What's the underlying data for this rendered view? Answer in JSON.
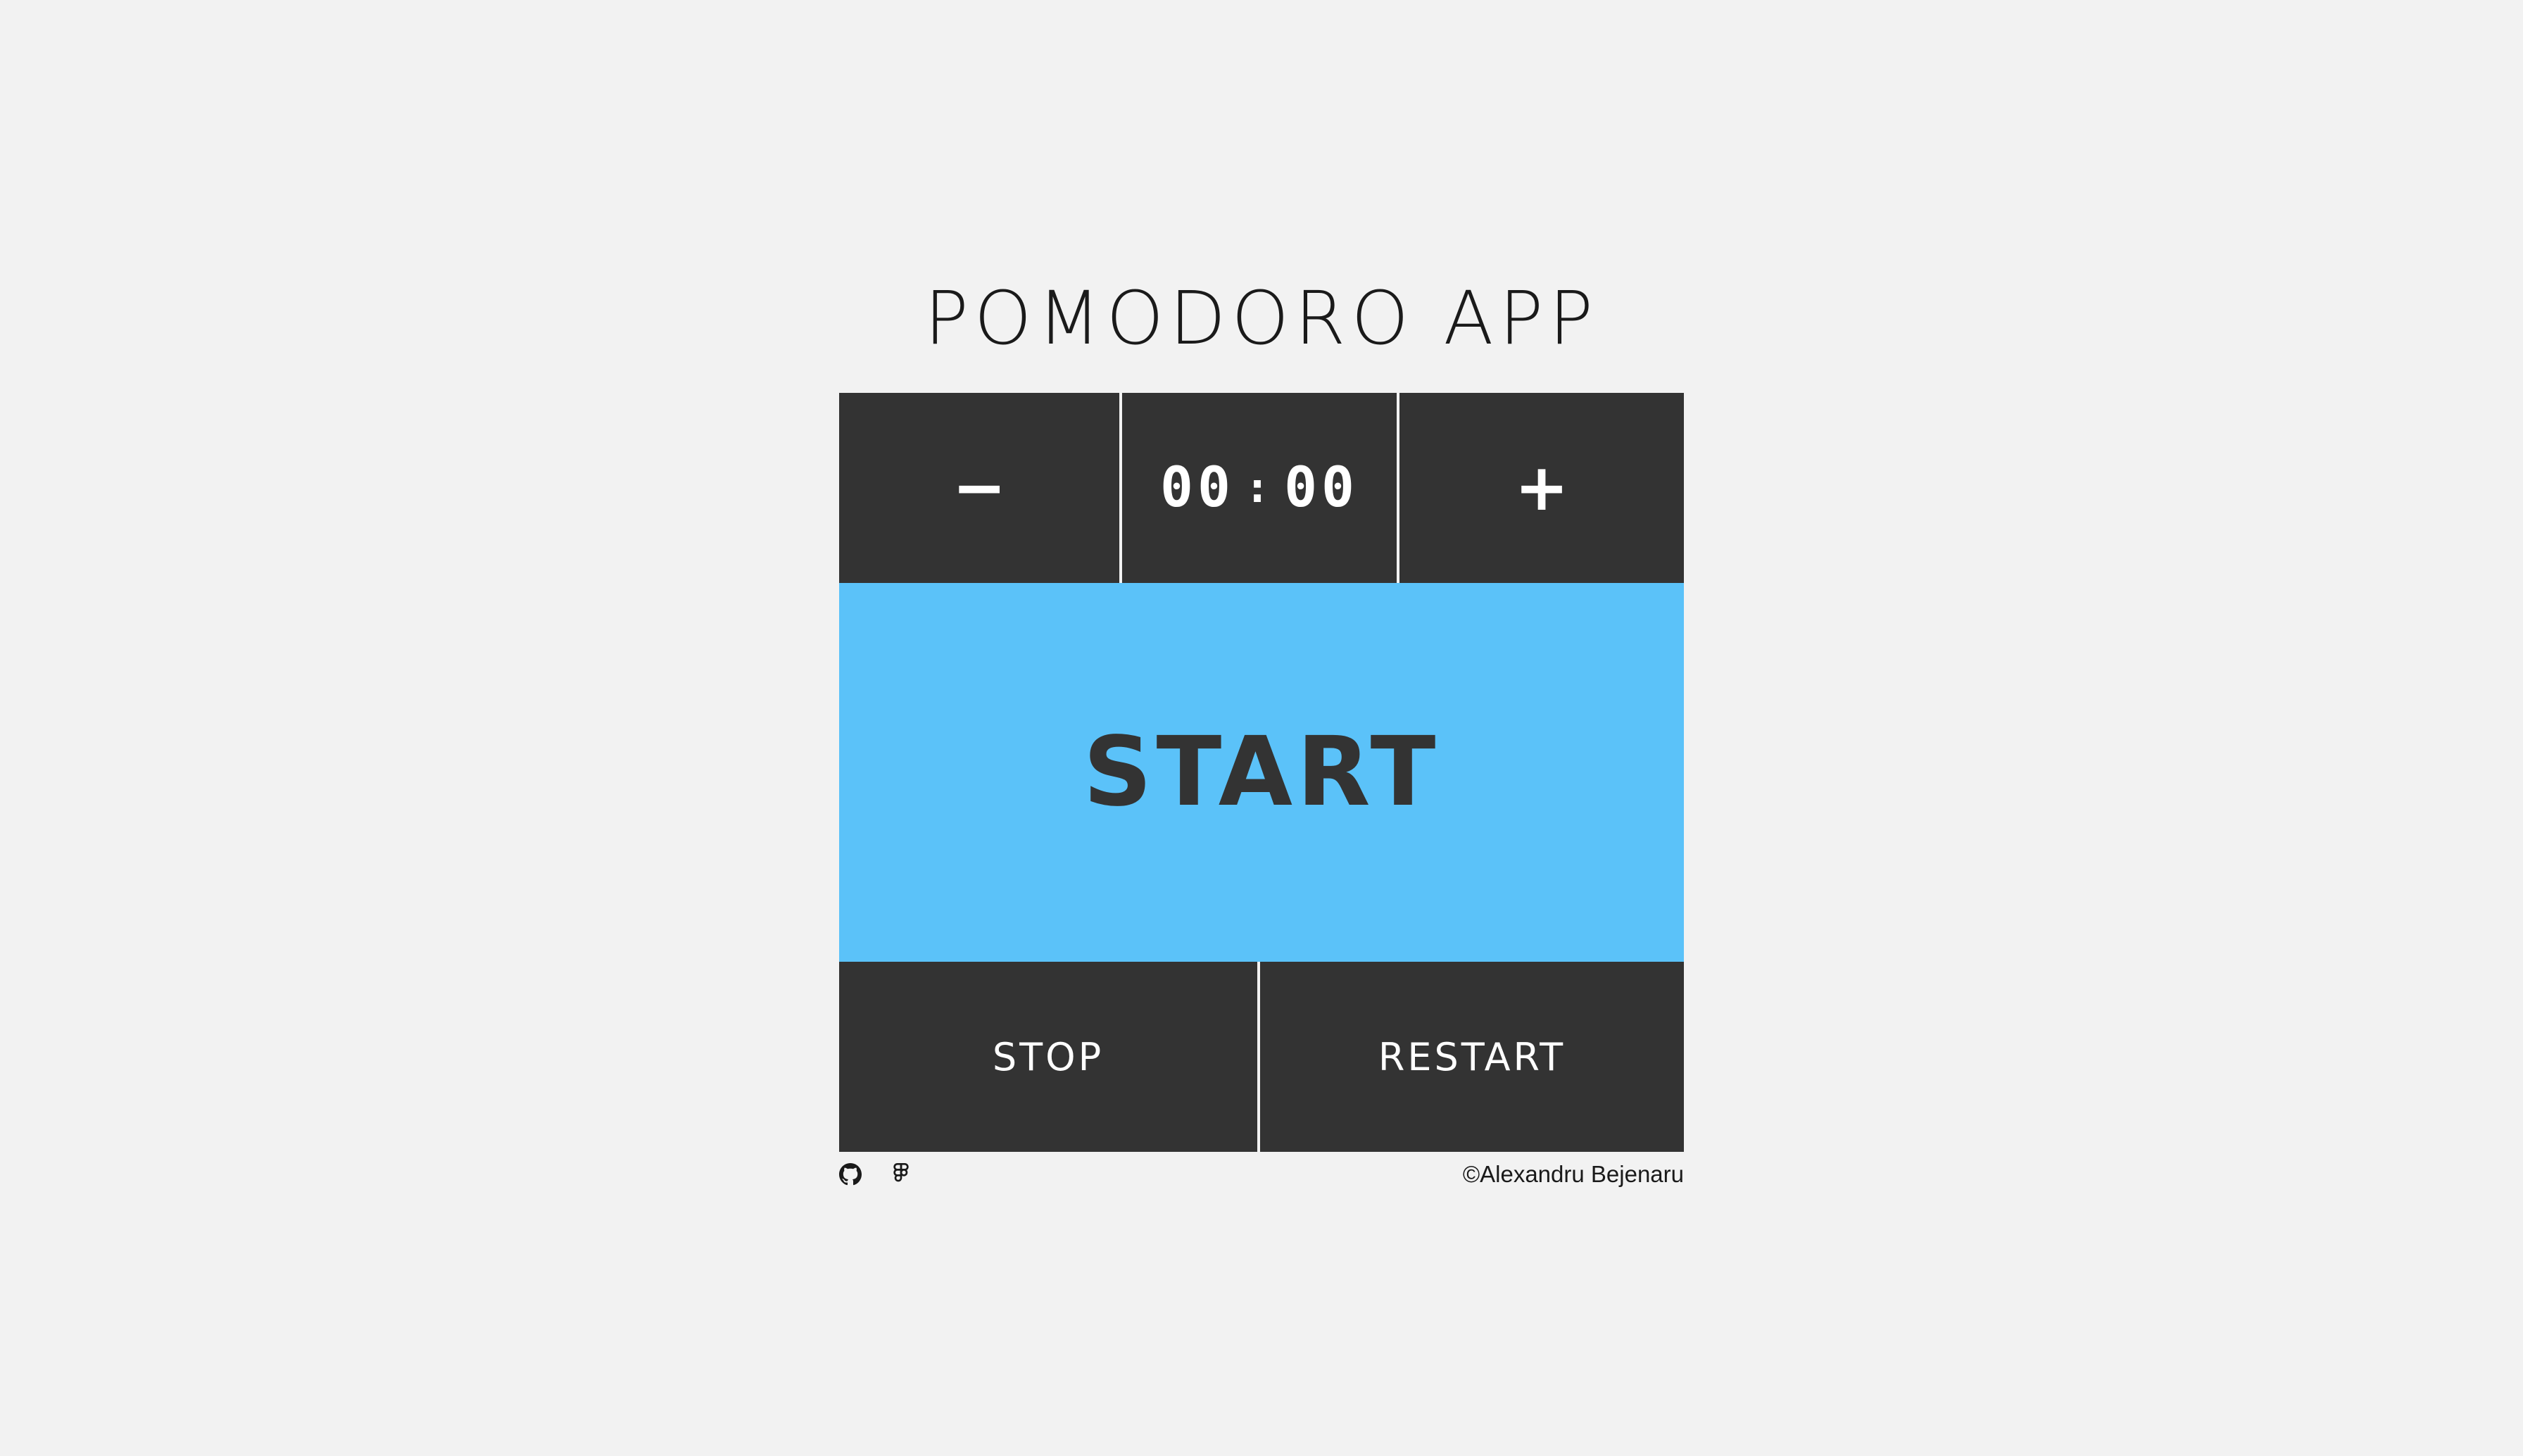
{
  "app": {
    "title": "POMODORO APP"
  },
  "timer": {
    "decrement_label": "−",
    "increment_label": "+",
    "minutes": "00",
    "separator": ":",
    "seconds": "00"
  },
  "controls": {
    "start_label": "START",
    "stop_label": "STOP",
    "restart_label": "RESTART"
  },
  "footer": {
    "icons": [
      "github-icon",
      "figma-icon"
    ],
    "credit": "©Alexandru Bejenaru"
  },
  "colors": {
    "background": "#f2f2f2",
    "panel": "#333333",
    "accent": "#5bc2f9",
    "text_light": "#ffffff",
    "text_dark": "#333333"
  }
}
